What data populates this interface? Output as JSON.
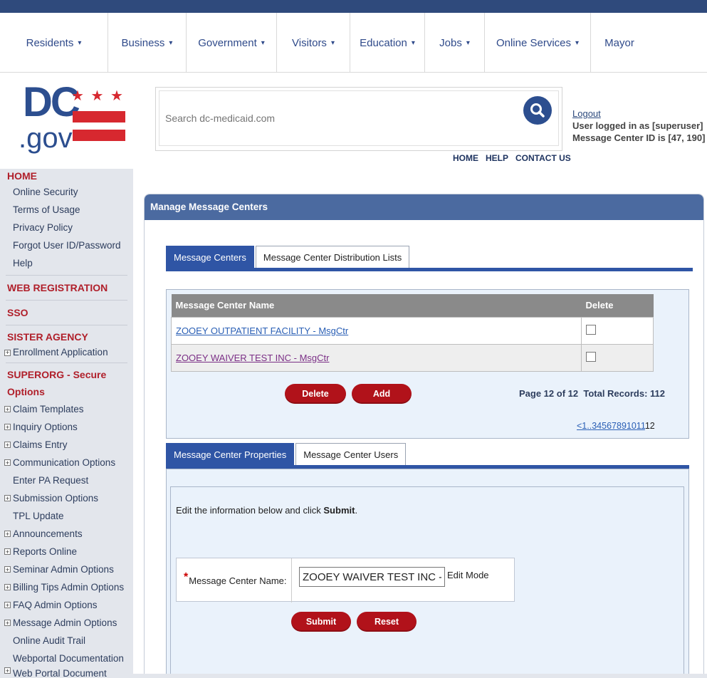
{
  "nav": {
    "items": [
      {
        "label": "Residents",
        "caret": "▾"
      },
      {
        "label": "Business",
        "caret": "▾"
      },
      {
        "label": "Government",
        "caret": "▾"
      },
      {
        "label": "Visitors",
        "caret": "▾"
      },
      {
        "label": "Education",
        "caret": "▾"
      },
      {
        "label": "Jobs",
        "caret": "▾"
      },
      {
        "label": "Online Services",
        "caret": "▾"
      },
      {
        "label": "Mayor",
        "caret": ""
      }
    ]
  },
  "logo": {
    "top": "DC",
    "bottom": ".gov",
    "stars": "★ ★ ★"
  },
  "search": {
    "placeholder": "Search dc-medicaid.com",
    "icon": "search-icon"
  },
  "utility": {
    "home": "HOME",
    "help": "HELP",
    "contact": "CONTACT US"
  },
  "user": {
    "logout": "Logout",
    "logged_in": "User logged in as [superuser]",
    "msg_center_id": "Message Center ID is [47, 190]"
  },
  "sidebar": {
    "home": "HOME",
    "home_items": [
      "Online Security",
      "Terms of Usage",
      "Privacy Policy",
      "Forgot User ID/Password",
      "Help"
    ],
    "web_registration": "WEB REGISTRATION",
    "sso": "SSO",
    "sister_agency": "SISTER AGENCY",
    "enrollment": "Enrollment Application",
    "superorg": "SUPERORG - Secure Options",
    "superorg_items": [
      {
        "label": "Claim Templates",
        "exp": true
      },
      {
        "label": "Inquiry Options",
        "exp": true
      },
      {
        "label": "Claims Entry",
        "exp": true
      },
      {
        "label": "Communication Options",
        "exp": true
      },
      {
        "label": "Enter PA Request",
        "exp": false
      },
      {
        "label": "Submission Options",
        "exp": true
      },
      {
        "label": "TPL Update",
        "exp": false
      },
      {
        "label": "Announcements",
        "exp": true
      },
      {
        "label": "Reports Online",
        "exp": true
      },
      {
        "label": "Seminar Admin Options",
        "exp": true
      },
      {
        "label": "Billing Tips Admin Options",
        "exp": true
      },
      {
        "label": "FAQ Admin Options",
        "exp": true
      },
      {
        "label": "Message Admin Options",
        "exp": true
      },
      {
        "label": "Online Audit Trail",
        "exp": false
      },
      {
        "label": "Webportal Documentation",
        "exp": false
      },
      {
        "label": "Web Portal Document Admin Options",
        "exp": true
      }
    ]
  },
  "panel": {
    "title": "Manage Message Centers",
    "tabs": [
      "Message Centers",
      "Message Center Distribution Lists"
    ],
    "table": {
      "headers": [
        "Message Center Name",
        "Delete"
      ],
      "rows": [
        "ZOOEY OUTPATIENT FACILITY - MsgCtr",
        "ZOOEY WAIVER TEST INC - MsgCtr"
      ]
    },
    "delete_label": "Delete",
    "add_label": "Add",
    "page_info": "Page 12 of 12",
    "total_records": "Total Records: 112",
    "page_links": [
      "<1",
      "..",
      "3",
      "4",
      "5",
      "6",
      "7",
      "8",
      "9",
      "10",
      "11"
    ],
    "current_page": "12",
    "tabs2": [
      "Message Center Properties",
      "Message Center Users"
    ],
    "instructions_pre": "Edit the information below and click ",
    "instructions_bold": "Submit",
    "instructions_post": ".",
    "form": {
      "required_mark": "*",
      "label": "Message Center Name:",
      "value": "ZOOEY WAIVER TEST INC - MsgCtr",
      "mode": "Edit Mode"
    },
    "submit_label": "Submit",
    "reset_label": "Reset"
  },
  "colors": {
    "header": "#4b6aa0",
    "tab_active": "#2f55a5",
    "button": "#b1121a",
    "sidebar_head": "#b01f2a"
  }
}
